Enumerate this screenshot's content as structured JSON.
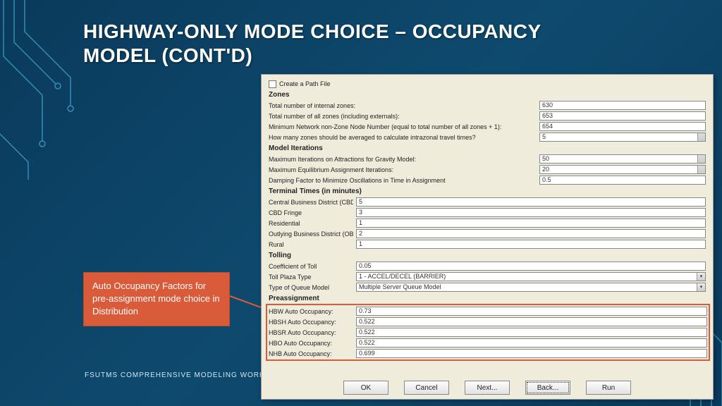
{
  "title": "HIGHWAY-ONLY MODE CHOICE – OCCUPANCY MODEL (CONT'D)",
  "footer": "FSUTMS COMPREHENSIVE MODELING WORKSHOP",
  "callout": "Auto Occupancy Factors for pre-assignment mode choice in Distribution",
  "dialog": {
    "checkbox_label": "Create a Path File",
    "zones": {
      "head": "Zones",
      "r1_label": "Total number of internal zones:",
      "r1_value": "630",
      "r2_label": "Total number of all zones (including externals):",
      "r2_value": "653",
      "r3_label": "Minimum Network non-Zone Node Number (equal to total number of all zones + 1):",
      "r3_value": "654",
      "r4_label": "How many zones should be averaged to calculate intrazonal travel times?",
      "r4_value": "5"
    },
    "iterations": {
      "head": "Model Iterations",
      "r1_label": "Maximum Iterations on Attractions for Gravity Model:",
      "r1_value": "50",
      "r2_label": "Maximum Equilibrium Assignment Iterations:",
      "r2_value": "20",
      "r3_label": "Damping Factor to Minimize Oscillations in Time in Assignment",
      "r3_value": "0.5"
    },
    "terminal": {
      "head": "Terminal Times (in minutes)",
      "r1_label": "Central Business District (CBD)",
      "r1_value": "5",
      "r2_label": "CBD Fringe",
      "r2_value": "3",
      "r3_label": "Residential",
      "r3_value": "1",
      "r4_label": "Outlying Business District (OBD)",
      "r4_value": "2",
      "r5_label": "Rural",
      "r5_value": "1"
    },
    "tolling": {
      "head": "Tolling",
      "r1_label": "Coefficient of Toll",
      "r1_value": "0.05",
      "r2_label": "Toll Plaza Type",
      "r2_value": "1 - ACCEL/DECEL (BARRIER)",
      "r3_label": "Type of Queue Model",
      "r3_value": "Multiple Server Queue Model"
    },
    "preassign": {
      "head": "Preassignment",
      "r1_label": "HBW Auto Occupancy:",
      "r1_value": "0.73",
      "r2_label": "HBSH Auto Occupancy:",
      "r2_value": "0.522",
      "r3_label": "HBSR Auto Occupancy:",
      "r3_value": "0.522",
      "r4_label": "HBO Auto Occupancy:",
      "r4_value": "0.522",
      "r5_label": "NHB Auto Occupancy:",
      "r5_value": "0.699"
    },
    "buttons": {
      "ok": "OK",
      "cancel": "Cancel",
      "next": "Next...",
      "back": "Back...",
      "run": "Run"
    }
  }
}
